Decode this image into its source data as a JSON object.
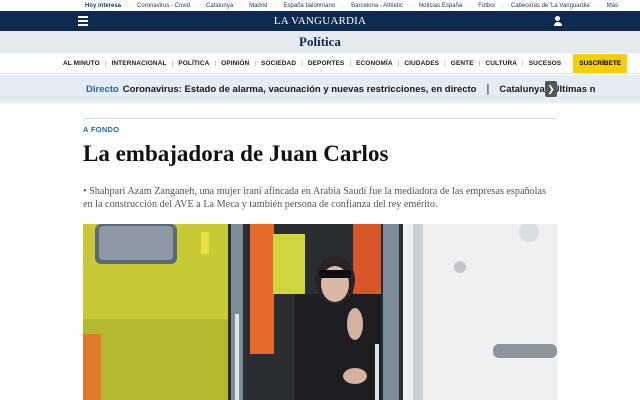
{
  "topbar": {
    "hot_label": "Hoy interesa",
    "links": [
      "Coronavirus - Covid",
      "Catalunya",
      "Madrid",
      "España balonmano",
      "Barcelona - Athletic",
      "Noticias España",
      "Fútbol",
      "Cabeceras de 'La Vanguardia'",
      "Más"
    ]
  },
  "header": {
    "logo": "LA VANGUARDIA",
    "menu_icon": "hamburger-menu-icon",
    "user_icon": "user-icon",
    "brand_color": "#0e2a4f"
  },
  "section": {
    "title": "Política"
  },
  "nav": {
    "items": [
      "AL MINUTO",
      "INTERNACIONAL",
      "POLÍTICA",
      "OPINIÓN",
      "SOCIEDAD",
      "DEPORTES",
      "ECONOMÍA",
      "CIUDADES",
      "GENTE",
      "CULTURA",
      "SUCESOS"
    ],
    "subscribe": "SUSCRÍBETE",
    "subscribe_color": "#f4d000"
  },
  "ticker": {
    "label": "Directo",
    "text": "Coronavirus: Estado de alarma, vacunación y nuevas restricciones, en directo",
    "separator": "|",
    "text2": "Catalunya | Últimas noticias",
    "next_icon": "chevron-right-icon"
  },
  "article": {
    "kicker": "A FONDO",
    "title": "La embajadora de Juan Carlos",
    "bullet": "•",
    "dek": "Shahpari Azam Zanganeh, una mujer iraní afincada en Arabia Saudí fue la mediadora de las empresas españolas en la construcción del AVE a La Meca y también persona de confianza del rey emérito."
  }
}
